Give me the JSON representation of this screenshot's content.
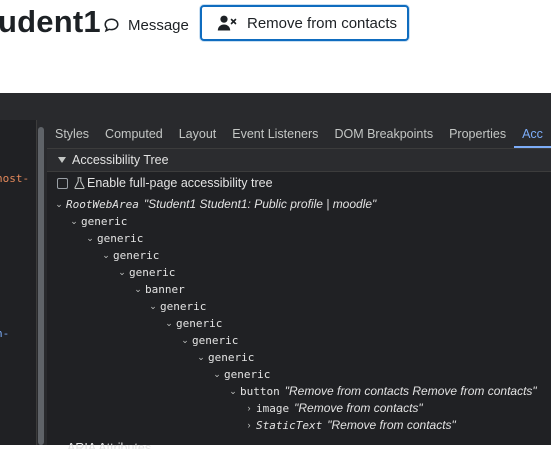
{
  "page": {
    "title": "udent1",
    "message_label": "Message",
    "remove_label": "Remove from contacts"
  },
  "elements_pane": {
    "snippet_1": "host-",
    "snippet_2": "n-"
  },
  "devtools": {
    "tabs": [
      {
        "label": "Styles"
      },
      {
        "label": "Computed"
      },
      {
        "label": "Layout"
      },
      {
        "label": "Event Listeners"
      },
      {
        "label": "DOM Breakpoints"
      },
      {
        "label": "Properties"
      },
      {
        "label": "Acc"
      }
    ],
    "section_title": "Accessibility Tree",
    "enable_label": "Enable full-page accessibility tree",
    "bottom_section": "ARIA Attributes",
    "tree": [
      {
        "role": "RootWebArea",
        "name": "\"Student1 Student1: Public profile | moodle\""
      },
      {
        "role": "generic"
      },
      {
        "role": "generic"
      },
      {
        "role": "generic"
      },
      {
        "role": "generic"
      },
      {
        "role": "banner"
      },
      {
        "role": "generic"
      },
      {
        "role": "generic"
      },
      {
        "role": "generic"
      },
      {
        "role": "generic"
      },
      {
        "role": "generic"
      },
      {
        "role": "button",
        "name": "\"Remove from contacts Remove from contacts\""
      },
      {
        "role": "image",
        "name": "\"Remove from contacts\""
      },
      {
        "role": "StaticText",
        "name": "\"Remove from contacts\""
      }
    ]
  }
}
